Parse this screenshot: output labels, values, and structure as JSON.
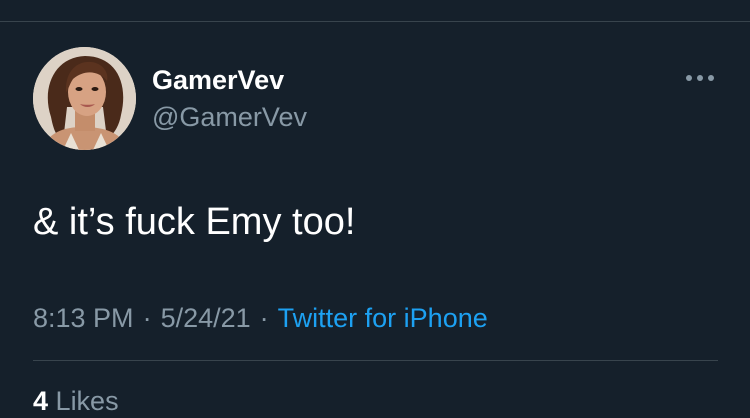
{
  "theme": {
    "background": "#15202b",
    "divider": "#38444d",
    "text_primary": "#ffffff",
    "text_secondary": "#8899a6",
    "accent": "#1da1f2"
  },
  "author": {
    "display_name": "GamerVev",
    "handle": "@GamerVev",
    "avatar": "profile-photo"
  },
  "menu": {
    "icon": "more-horizontal-icon"
  },
  "tweet": {
    "text": "& it’s fuck Emy too!",
    "time": "8:13 PM",
    "separator": "·",
    "date": "5/24/21",
    "source": "Twitter for iPhone"
  },
  "stats": {
    "likes_count": "4",
    "likes_label": "Likes"
  }
}
